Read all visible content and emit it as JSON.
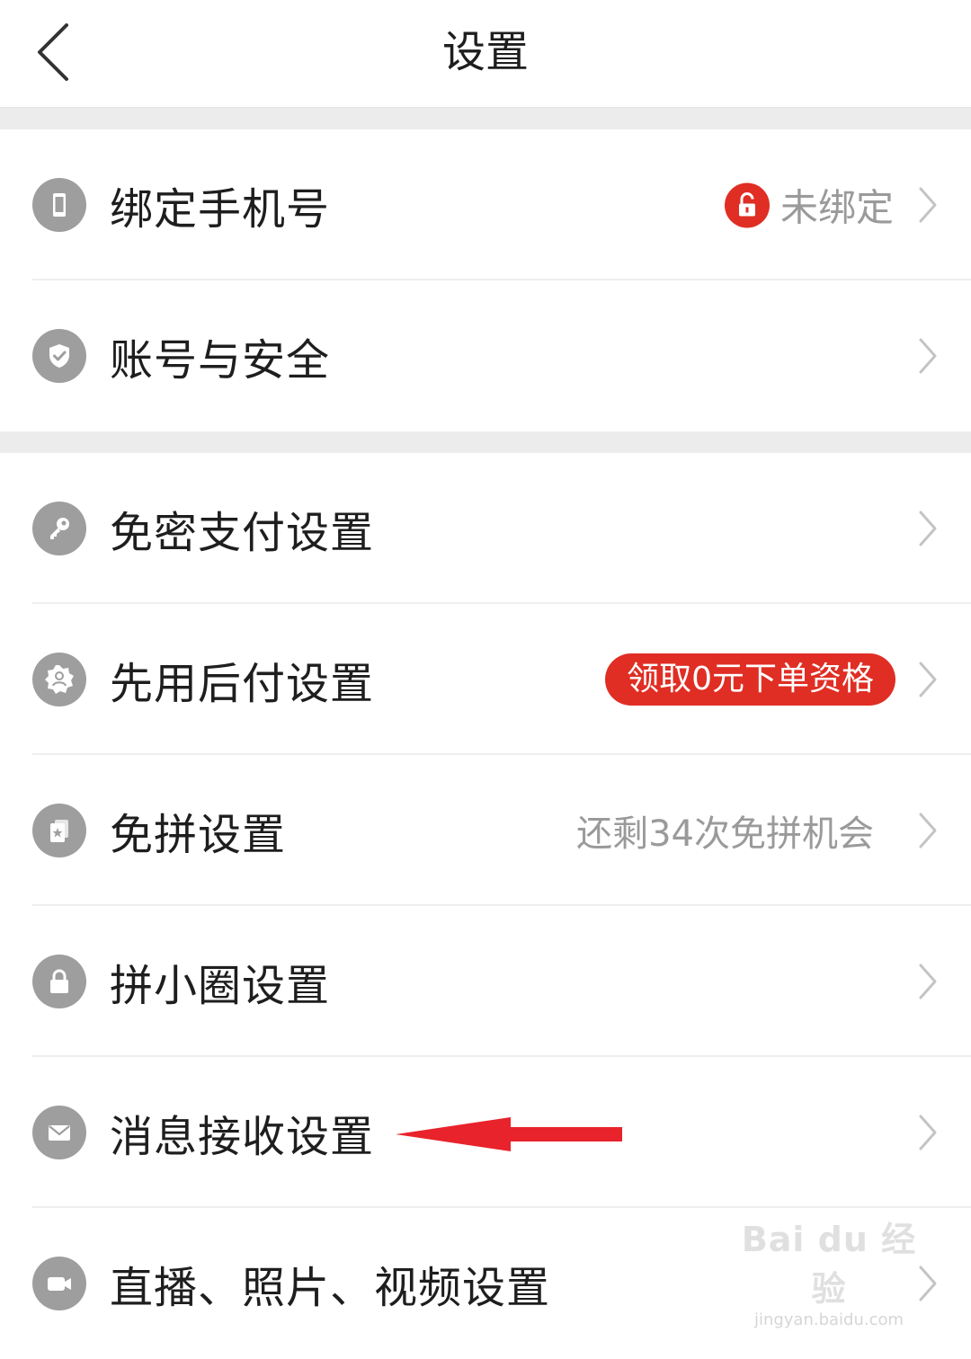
{
  "header": {
    "title": "设置",
    "back_icon": "chevron-left-icon"
  },
  "groups": [
    {
      "items": [
        {
          "id": "bind-phone",
          "label": "绑定手机号",
          "icon": "phone-icon",
          "status_icon": "unlock-icon",
          "status_text": "未绑定",
          "status_icon_color": "#e02e24"
        },
        {
          "id": "account-security",
          "label": "账号与安全",
          "icon": "shield-check-icon"
        }
      ]
    },
    {
      "items": [
        {
          "id": "password-free-payment",
          "label": "免密支付设置",
          "icon": "key-icon"
        },
        {
          "id": "pay-later",
          "label": "先用后付设置",
          "icon": "badge-user-icon",
          "badge": "领取0元下单资格",
          "badge_color": "#e02e24"
        },
        {
          "id": "group-free",
          "label": "免拼设置",
          "icon": "card-star-icon",
          "right_text": "还剩34次免拼机会"
        },
        {
          "id": "circle",
          "label": "拼小圈设置",
          "icon": "lock-icon"
        },
        {
          "id": "message-receive",
          "label": "消息接收设置",
          "icon": "mail-icon"
        },
        {
          "id": "media",
          "label": "直播、照片、视频设置",
          "icon": "video-camera-icon"
        }
      ]
    }
  ],
  "annotation": {
    "icon": "red-arrow-left-icon",
    "color": "#e8232b"
  },
  "watermark": {
    "main": "Bai du 经验",
    "sub": "jingyan.baidu.com"
  },
  "colors": {
    "accent": "#e02e24",
    "icon_bg": "#9e9e9e",
    "secondary_text": "#9a9a9a"
  }
}
